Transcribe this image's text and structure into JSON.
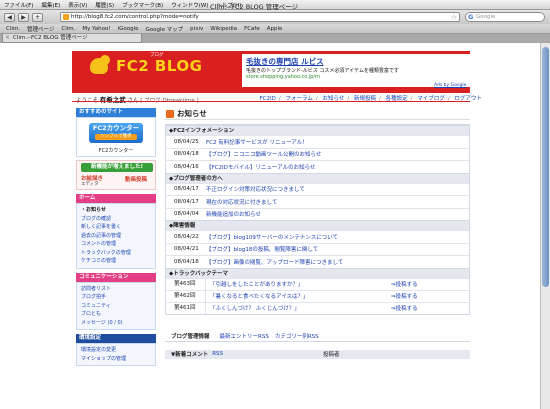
{
  "menubar": {
    "items": [
      "ファイル(F)",
      "編集(E)",
      "表示(V)",
      "履歴(S)",
      "ブックマーク(B)",
      "ウィンドウ(W)",
      "ヘルプ(H)"
    ],
    "window_title": "Clim.--FC2 BLOG 管理ページ"
  },
  "toolbar": {
    "back": "◀",
    "forward": "▶",
    "reload": "+",
    "url": "http://blog8.fc2.com/control.php?mode=notify",
    "search_placeholder": "Google"
  },
  "bookmarks": [
    "Clim.",
    "管理ページ",
    "Clim.",
    "My Yahoo!",
    "iGoogle",
    "Google マップ",
    "pixiv",
    "Wikipedia",
    "FCafe",
    "Apple"
  ],
  "tab": {
    "label": "Clim.--FC2 BLOG 管理ページ"
  },
  "banner": {
    "logo": "FC2 BLOG",
    "logo_sub": "ブログ",
    "ad_title": "毛抜きの専門店 ルビス",
    "ad_line": "毛抜きのトップブランド-ルビス コスメ必須アイテムを種類豊富です",
    "ad_url": "store.shopping.yahoo.co.jp/m",
    "ads_by": "Ads by Google"
  },
  "welcome": {
    "prefix": "ようこそ",
    "name": "有希之武",
    "suffix": "さん",
    "blog": "[ ブログ:Dbreaktime ]"
  },
  "topnav": [
    "FC2ID",
    "フォーラム",
    "お知らせ",
    "新規投稿",
    "各種設定",
    "マイブログ",
    "ログアウト"
  ],
  "sidebar": {
    "recommend_head": "おすすめのサイト",
    "counter_badge": "FC2カウンター",
    "counter_sub": "シンプルで簡単",
    "counter_label": "FC2カウンター",
    "newfeat_top": "新機能が増えました!",
    "newfeat_a": "お絵描き",
    "newfeat_b": "エディタ",
    "newfeat_c": "動画投稿",
    "home_head": "ホーム",
    "home_items": [
      "・お知らせ",
      "ブログの確認",
      "新しく記事を書く",
      "過去の記事の管理",
      "コメントの管理",
      "トラックバックの管理",
      "ケチコミの管理"
    ],
    "community_head": "コミュニケーション",
    "community_items": [
      "訪問者リスト",
      "ブログ拍手",
      "コミュニティ",
      "ブロとも",
      "メッセージ (0 / 0)"
    ],
    "env_head": "環境設定",
    "env_items": [
      "環境設定の変更",
      "マイショップの管理"
    ]
  },
  "main": {
    "title": "お知らせ",
    "sections": [
      {
        "heading": "◆FC2インフォメーション",
        "rows": [
          {
            "date": "08/04/25",
            "text": "FC2 有料記事サービスが リニューアル！"
          },
          {
            "date": "08/04/18",
            "text": "【ブログ】ニコニコ動画ツール公開のお知らせ"
          },
          {
            "date": "08/04/16",
            "text": "【FC2IDモバイル】リニューアルのお知らせ"
          }
        ]
      },
      {
        "heading": "◆ブログ管理者の方へ",
        "rows": [
          {
            "date": "08/04/17",
            "text": "不正ログイン対策対応状況につきまして"
          },
          {
            "date": "08/04/17",
            "text": "現在の対応状況に付きまして"
          },
          {
            "date": "08/04/04",
            "text": "新機能追加のお知らせ"
          }
        ]
      },
      {
        "heading": "◆障害情報",
        "rows": [
          {
            "date": "08/04/22",
            "text": "【ブログ】blog109サーバーのメンテナンスについて"
          },
          {
            "date": "08/04/21",
            "text": "【ブログ】blog18の投稿、閲覧障害に関して"
          },
          {
            "date": "08/04/18",
            "text": "【ブログ】画像の閲覧、アップロード障害につきまして"
          }
        ]
      }
    ],
    "trackback_heading": "◆トラックバックテーマ",
    "trackbacks": [
      {
        "no": "第463回",
        "theme": "「引越しをしたことがありますか？」",
        "post": "⇒投稿する"
      },
      {
        "no": "第462回",
        "theme": "「暑くなると食べたくなるアイスは？」",
        "post": "⇒投稿する"
      },
      {
        "no": "第461回",
        "theme": "「ふくしんづけ？ ふくじんづけ？」",
        "post": "⇒投稿する"
      }
    ],
    "mgmt_heading": "ブログ管理情報",
    "mgmt_links": [
      "最新エントリーRSS",
      "カテゴリー別RSS"
    ],
    "rss_heading": "▼新着コメント",
    "rss_link": "RSS",
    "rss_right": "投稿者"
  },
  "colors": {
    "banner_red": "#d91f1f",
    "link_blue": "#1a3fb0",
    "sidebar_blue": "#2c80d8",
    "sidebar_pink": "#e43f86"
  }
}
